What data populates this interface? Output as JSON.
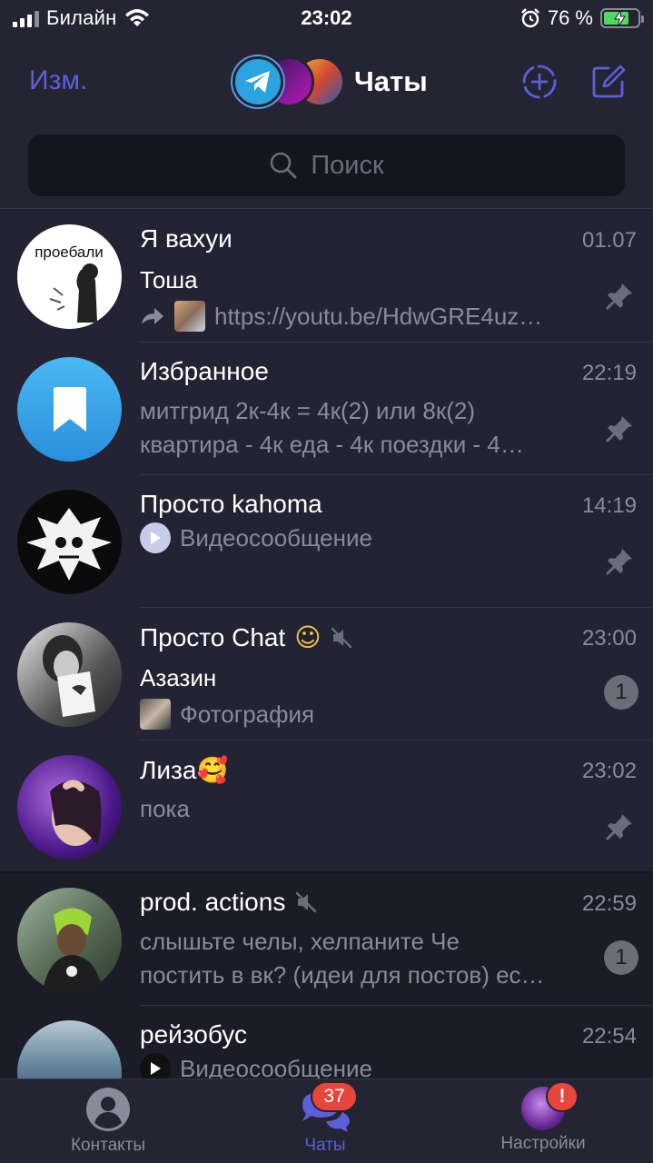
{
  "status_bar": {
    "carrier": "Билайн",
    "time": "23:02",
    "battery_percent": "76 %",
    "battery_level": 0.76
  },
  "header": {
    "edit_label": "Изм.",
    "title": "Чаты",
    "search_placeholder": "Поиск"
  },
  "colors": {
    "accent": "#5b5fd9",
    "background": "#1c1c28",
    "pinned_background": "#232333",
    "badge_red": "#e8453c",
    "secondary_text": "#8a8a9a"
  },
  "chats": [
    {
      "name": "Я вахуи",
      "time": "01.07",
      "sender": "Тоша",
      "preview": "https://youtu.be/HdwGRE4uz…",
      "pinned": true,
      "avatar_text": "проебали"
    },
    {
      "name": "Избранное",
      "time": "22:19",
      "preview_line1": "митгрид 2к-4к = 4к(2) или 8к(2)",
      "preview_line2": "квартира - 4к еда - 4к поездки - 4…",
      "pinned": true
    },
    {
      "name": "Просто kahoma",
      "time": "14:19",
      "preview": "Видеосообщение",
      "pinned": true
    },
    {
      "name": "Просто Chat",
      "emoji": "☺",
      "muted": true,
      "time": "23:00",
      "sender": "Азазин",
      "preview": "Фотография",
      "unread": "1"
    },
    {
      "name": "Лиза",
      "emoji": "🥰",
      "time": "23:02",
      "preview": "пока",
      "pinned": true
    },
    {
      "name": "prod. actions",
      "muted": true,
      "time": "22:59",
      "preview_line1": "слышьте челы, хелпаните Че",
      "preview_line2": "постить в вк? (идеи для постов) ес…",
      "unread": "1"
    },
    {
      "name": "рейзобус",
      "time": "22:54",
      "preview": "Видеосообщение"
    }
  ],
  "tabs": [
    {
      "label": "Контакты",
      "icon": "person-icon"
    },
    {
      "label": "Чаты",
      "icon": "chat-bubbles-icon",
      "badge": "37"
    },
    {
      "label": "Настройки",
      "icon": "profile-avatar-icon",
      "badge": "!"
    }
  ]
}
